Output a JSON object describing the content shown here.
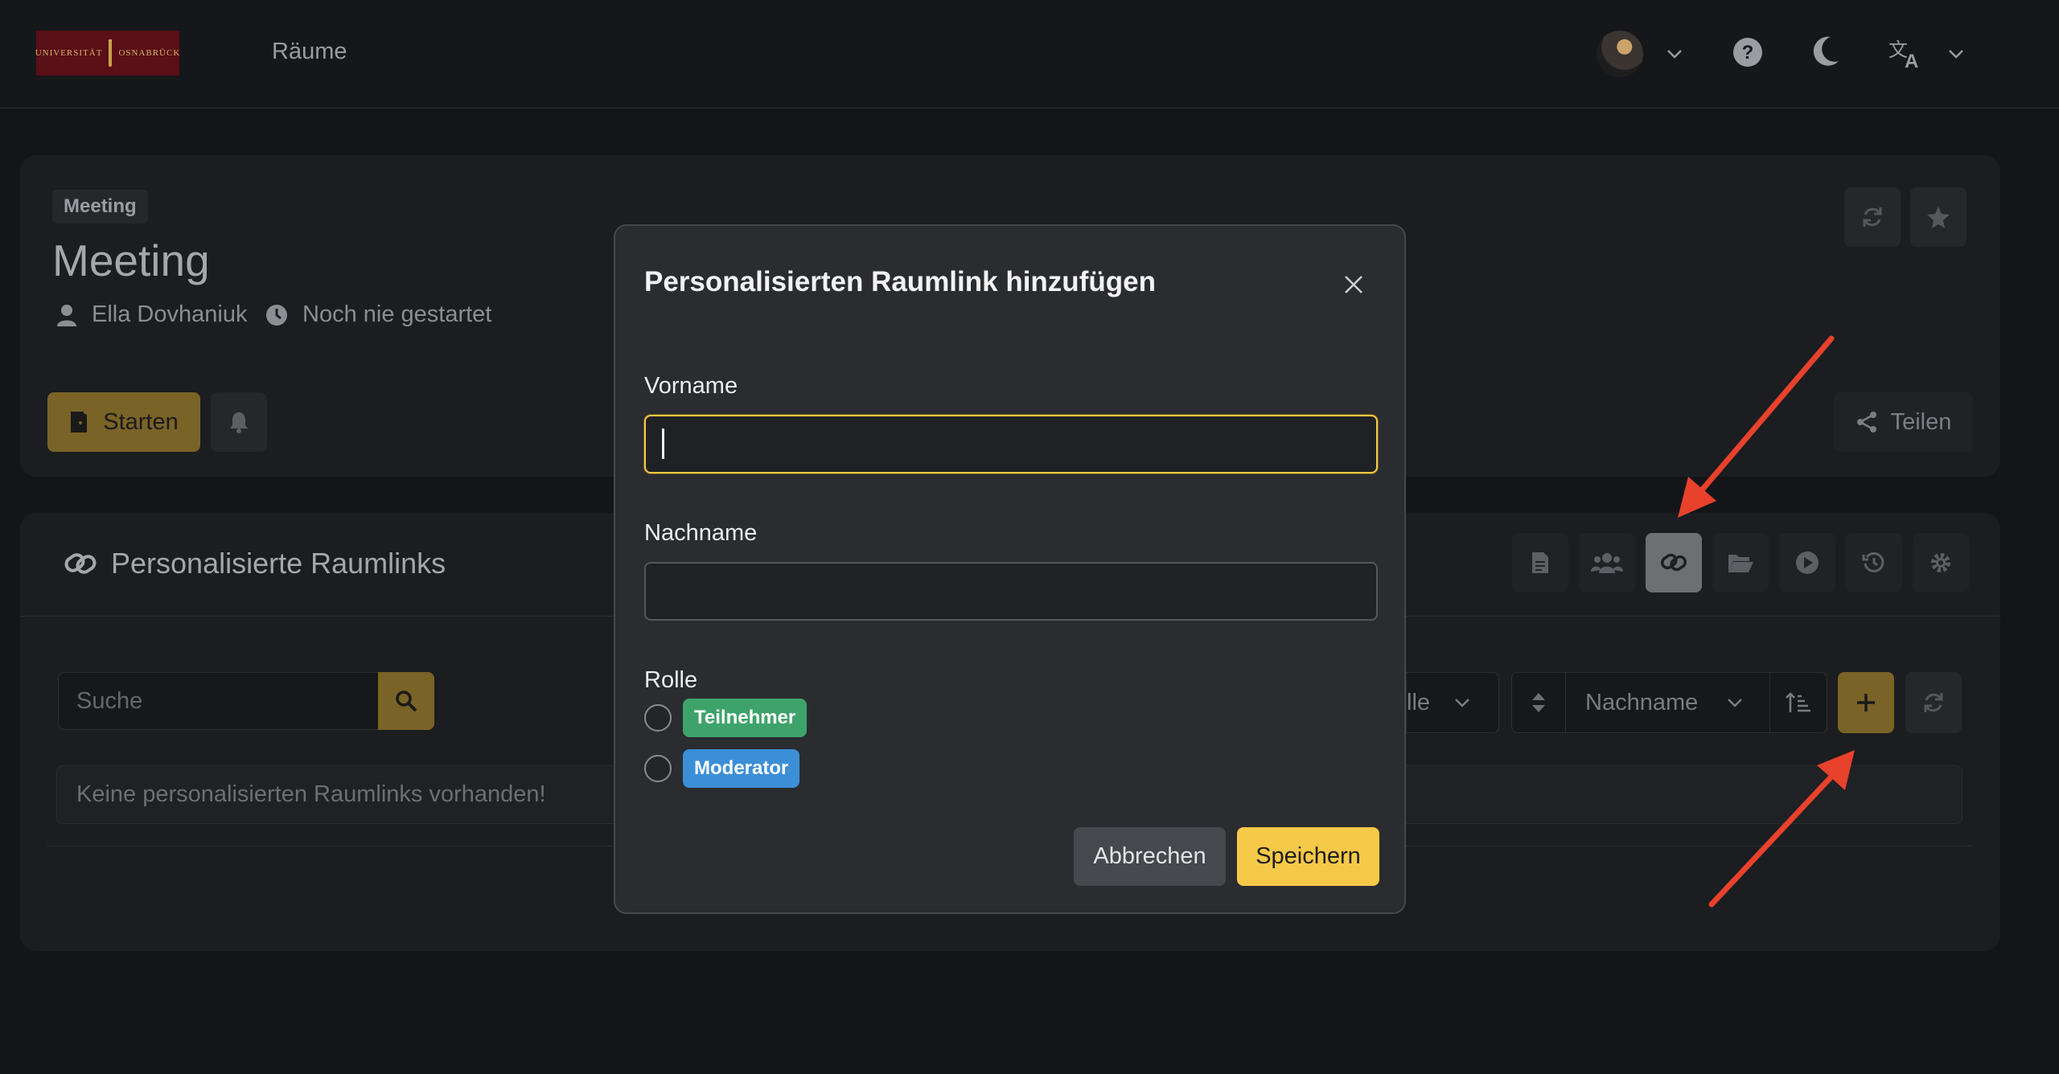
{
  "navbar": {
    "logo_text_left": "UNIVERSITÄT",
    "logo_text_right": "OSNABRÜCK",
    "nav_link": "Räume"
  },
  "room": {
    "type_badge": "Meeting",
    "title": "Meeting",
    "owner": "Ella Dovhaniuk",
    "status": "Noch nie gestartet",
    "start_label": "Starten",
    "share_label": "Teilen"
  },
  "personal_links": {
    "title": "Personalisierte Raumlinks",
    "search_placeholder": "Suche",
    "filter_partial": "lle",
    "sort_label": "Nachname",
    "empty_message": "Keine personalisierten Raumlinks vorhanden!"
  },
  "modal": {
    "title": "Personalisierten Raumlink hinzufügen",
    "firstname_label": "Vorname",
    "firstname_value": "",
    "lastname_label": "Nachname",
    "lastname_value": "",
    "role_label": "Rolle",
    "roles": [
      "Teilnehmer",
      "Moderator"
    ],
    "cancel_label": "Abbrechen",
    "save_label": "Speichern"
  },
  "colors": {
    "accent": "#f7c948",
    "participant": "#3ea36a",
    "moderator": "#3c8fd6",
    "annotation_arrow": "#e8412c"
  },
  "icons": [
    "user-icon",
    "clock-icon",
    "door-icon",
    "bell-icon",
    "share-icon",
    "link-icon",
    "search-icon",
    "plus-icon",
    "refresh-icon",
    "star-icon",
    "close-icon",
    "moon-icon",
    "help-icon",
    "translate-icon",
    "chevron-down-icon"
  ]
}
